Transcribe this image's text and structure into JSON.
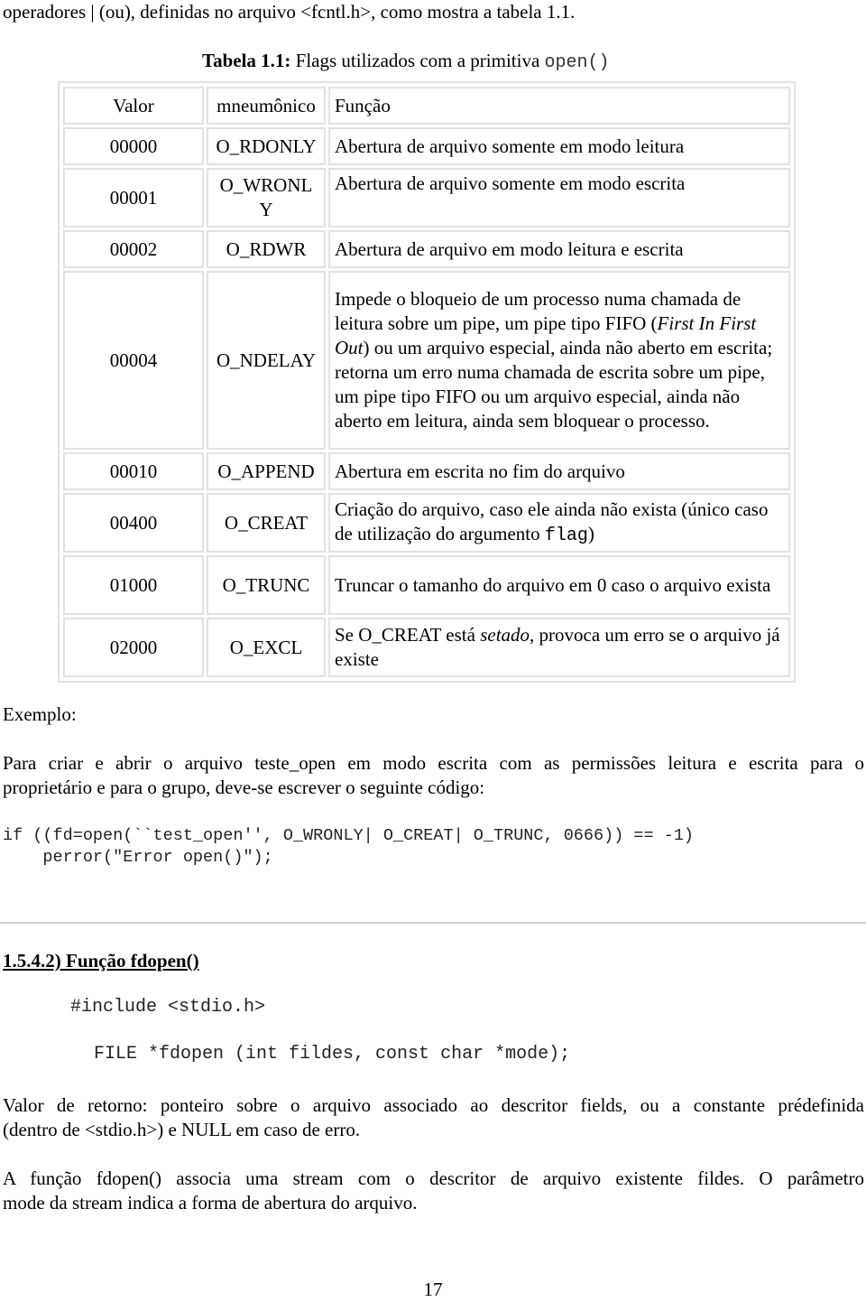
{
  "intro_text": "operadores | (ou), definidas no arquivo <fcntl.h>, como mostra a tabela 1.1.",
  "caption": {
    "label": "Tabela 1.1:",
    "text": " Flags utilizados com a primitiva ",
    "code": "open()"
  },
  "table": {
    "headers": [
      "Valor",
      "mneumônico",
      "Função"
    ],
    "rows": [
      {
        "valor": "00000",
        "mnemonic": "O_RDONLY",
        "funcao": "Abertura de arquivo somente em modo leitura"
      },
      {
        "valor": "00001",
        "mnemonic_line1": "O_WRONL",
        "mnemonic_line2": "Y",
        "funcao": "Abertura de arquivo somente em modo escrita"
      },
      {
        "valor": "00002",
        "mnemonic": "O_RDWR",
        "funcao": "Abertura de arquivo em modo leitura e escrita"
      },
      {
        "valor": "00004",
        "mnemonic": "O_NDELAY",
        "funcao_parts": {
          "a": "Impede o bloqueio de um processo numa chamada de leitura sobre um pipe, um pipe tipo FIFO (",
          "italic": "First In First Out",
          "b": ") ou um arquivo especial, ainda não aberto em escrita; retorna um erro numa chamada de escrita sobre um pipe, um pipe tipo FIFO ou um arquivo especial, ainda não aberto em leitura, ainda sem bloquear o processo."
        }
      },
      {
        "valor": "00010",
        "mnemonic": "O_APPEND",
        "funcao": "Abertura em escrita no fim do arquivo"
      },
      {
        "valor": "00400",
        "mnemonic": "O_CREAT",
        "funcao_parts": {
          "a": "Criação do arquivo, caso ele ainda não exista (único caso de utilização do argumento ",
          "code": "flag",
          "b": ")"
        }
      },
      {
        "valor": "01000",
        "mnemonic": "O_TRUNC",
        "funcao": "Truncar o tamanho do arquivo em 0 caso o arquivo exista"
      },
      {
        "valor": "02000",
        "mnemonic": "O_EXCL",
        "funcao_parts": {
          "a": "Se O_CREAT está ",
          "italic": "setado",
          "b": ", provoca um erro se o arquivo já existe"
        }
      }
    ]
  },
  "example_label": "Exemplo:",
  "example_paragraph": {
    "line1": "Para criar e abrir o arquivo teste_open em modo escrita com as permissões leitura e escrita para o",
    "line2": "proprietário e para o grupo, deve-se escrever o seguinte código:"
  },
  "code_example": {
    "line1": "if ((fd=open(``test_open'', O_WRONLY| O_CREAT| O_TRUNC, 0666)) == -1)",
    "line2": "    perror(\"Error open()\");"
  },
  "section_heading": "1.5.4.2) Função fdopen()",
  "include_line": "#include <stdio.h>",
  "signature_line": "FILE *fdopen (int fildes, const char *mode);",
  "return_paragraph": {
    "line1": "Valor de retorno: ponteiro sobre o arquivo associado ao descritor fields, ou a constante prédefinida",
    "line2": "(dentro de <stdio.h>) e NULL em caso de erro."
  },
  "description_paragraph": {
    "line1": "A função fdopen() associa uma stream com o descritor de arquivo existente fildes. O parâmetro",
    "line2": "mode da stream indica a forma de abertura do arquivo."
  },
  "page_number": "17"
}
